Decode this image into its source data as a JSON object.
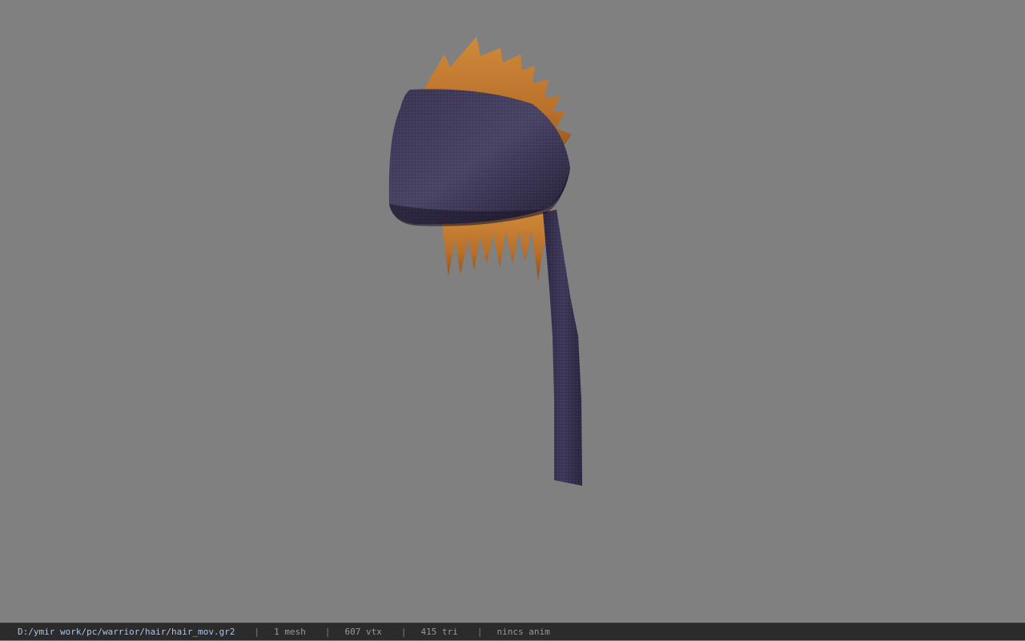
{
  "viewport": {
    "background_color": "#808080",
    "model": {
      "kind": "hair-with-headband",
      "hair_color": "#c0772a",
      "band_color": "#3c3558"
    }
  },
  "status_bar": {
    "file_path": "D:/ymir work/pc/warrior/hair/hair_mov.gr2",
    "separator": "|",
    "mesh_count": "1 mesh",
    "vertex_count": "607 vtx",
    "triangle_count": "415 tri",
    "animation": "nincs anim"
  }
}
